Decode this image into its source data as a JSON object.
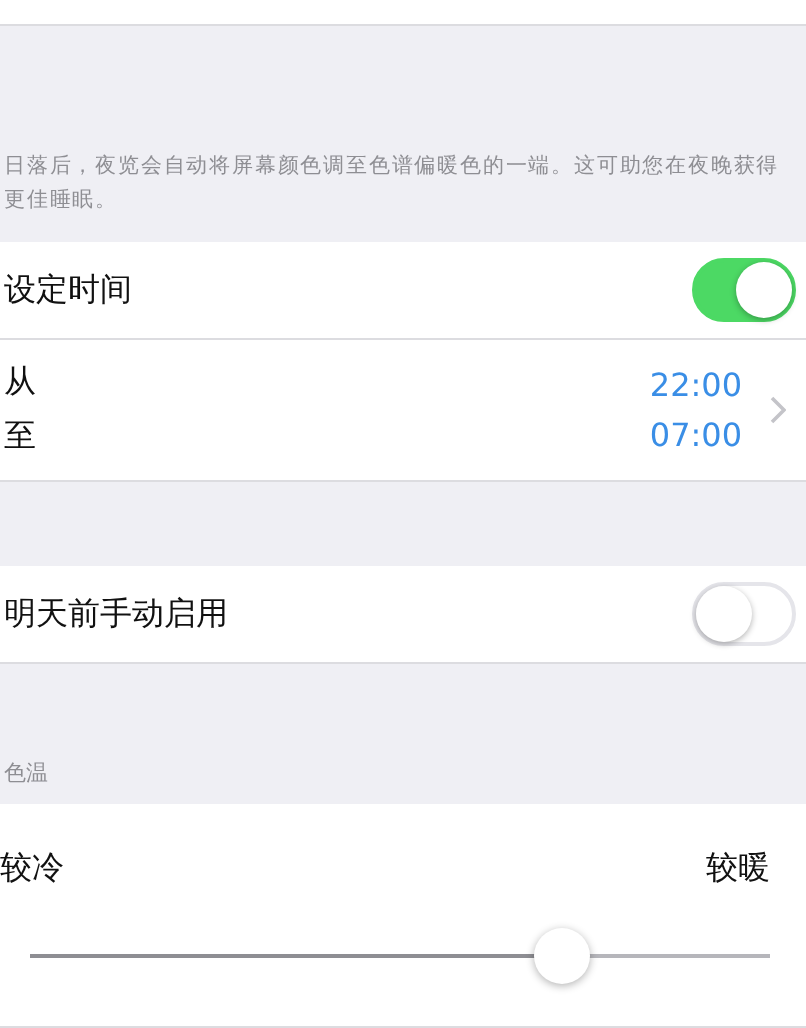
{
  "description": "日落后，夜览会自动将屏幕颜色调至色谱偏暖色的一端。这可助您在夜晚获得更佳睡眠。",
  "schedule": {
    "label": "设定时间",
    "on": true
  },
  "times": [
    {
      "label": "从",
      "value": "22:00"
    },
    {
      "label": "至",
      "value": "07:00"
    }
  ],
  "manual": {
    "label": "明天前手动启用",
    "on": false
  },
  "temperature": {
    "header": "色温",
    "cooler": "较冷",
    "warmer": "较暖",
    "level": 0.72
  }
}
